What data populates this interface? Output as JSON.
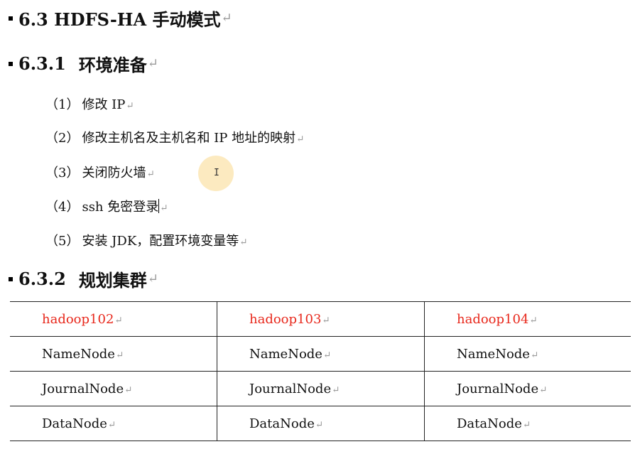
{
  "paragraph_mark": "↵",
  "h1": {
    "text": "6.3 HDFS-HA 手动模式"
  },
  "section1": {
    "number": "6.3.1",
    "title": "环境准备",
    "items": [
      {
        "num": "（1）",
        "text": "修改 IP"
      },
      {
        "num": "（2）",
        "text": "修改主机名及主机名和 IP 地址的映射"
      },
      {
        "num": "（3）",
        "text": "关闭防火墙"
      },
      {
        "num": "（4）",
        "text": "ssh 免密登录"
      },
      {
        "num": "（5）",
        "text": "安装 JDK，配置环境变量等"
      }
    ]
  },
  "section2": {
    "number": "6.3.2",
    "title": "规划集群"
  },
  "table": {
    "header": [
      "hadoop102",
      "hadoop103",
      "hadoop104"
    ],
    "rows": [
      [
        "NameNode",
        "NameNode",
        "NameNode"
      ],
      [
        "JournalNode",
        "JournalNode",
        "JournalNode"
      ],
      [
        "DataNode",
        "DataNode",
        "DataNode"
      ]
    ]
  },
  "colors": {
    "host_text": "#e8281c",
    "cursor_highlight": "#fadc96",
    "paragraph_mark": "#9a9a9a"
  }
}
